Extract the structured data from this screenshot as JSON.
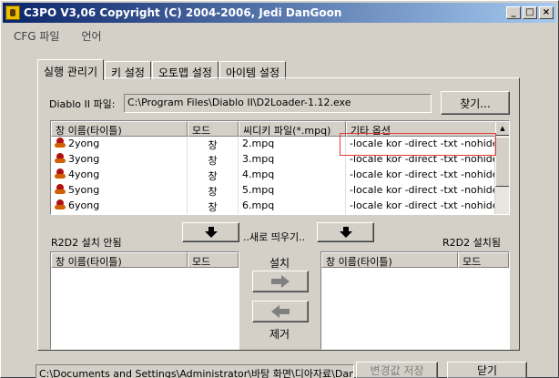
{
  "window": {
    "title": "C3PO V3,06 Copyright (C) 2004-2006, Jedi DanGoon",
    "minimize": "_",
    "maximize": "□",
    "close": "×"
  },
  "menu": [
    "CFG 파일",
    "언어"
  ],
  "tabs": [
    "실행 관리기",
    "키 설정",
    "오토맵 설정",
    "아이템 설정"
  ],
  "diablo": {
    "label": "Diablo II 파일:",
    "path": "C:\\Program Files\\Diablo II\\D2Loader-1.12.exe",
    "browse": "찾기..."
  },
  "main_list": {
    "columns": [
      "창 이름(타이틀)",
      "모드",
      "씨디키 파일(*.mpq)",
      "기타 옵션"
    ],
    "rows": [
      {
        "name": "2yong",
        "mode": "창",
        "mpq": "2.mpq",
        "options": "-locale kor -direct -txt -nohide"
      },
      {
        "name": "3yong",
        "mode": "창",
        "mpq": "3.mpq",
        "options": "-locale kor -direct -txt -nohide"
      },
      {
        "name": "4yong",
        "mode": "창",
        "mpq": "4.mpq",
        "options": "-locale kor -direct -txt -nohide"
      },
      {
        "name": "5yong",
        "mode": "창",
        "mpq": "5.mpq",
        "options": "-locale kor -direct -txt -nohide"
      },
      {
        "name": "6yong",
        "mode": "창",
        "mpq": "6.mpq",
        "options": "-locale kor -direct -txt -nohide"
      }
    ]
  },
  "r2d2": {
    "not_installed": "R2D2 설치 안됨",
    "refresh": "..새로 띄우기..",
    "installed": "R2D2 설치됨",
    "install": "설치",
    "remove": "제거",
    "left_columns": [
      "창 이름(타이틀)",
      "모드"
    ],
    "right_columns": [
      "창 이름(타이틀)",
      "모드"
    ]
  },
  "status": {
    "path": "C:\\Documents and Settings\\Administrator\\바탕 화면\\디아자료\\Dan Go",
    "save_changes": "변경값 저장",
    "close": "닫기"
  },
  "colors": {
    "titlebar_start": "#0a246a",
    "titlebar_end": "#a6caf0",
    "highlight": "#e83a3a"
  }
}
